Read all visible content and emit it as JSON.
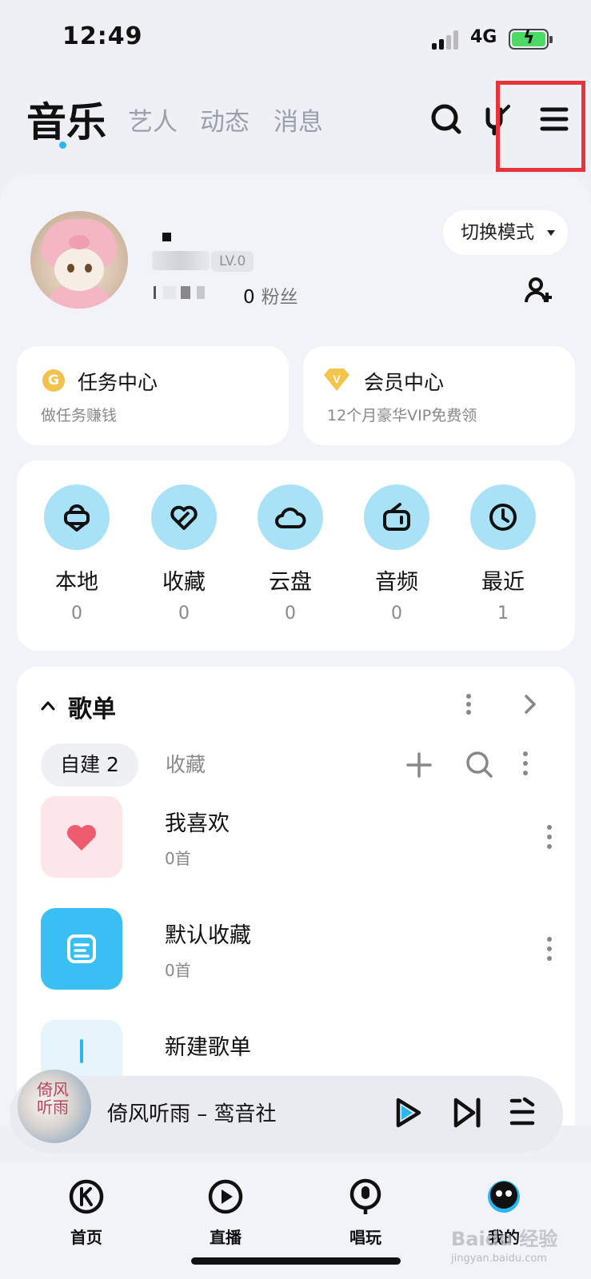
{
  "status": {
    "time": "12:49",
    "network": "4G"
  },
  "top_nav": {
    "tabs": [
      {
        "label": "音乐",
        "active": true
      },
      {
        "label": "艺人",
        "active": false
      },
      {
        "label": "动态",
        "active": false
      },
      {
        "label": "消息",
        "active": false
      }
    ]
  },
  "profile": {
    "level": "LV.0",
    "fans_count": "0",
    "fans_label": "粉丝",
    "mode_button": "切换模式"
  },
  "cards": {
    "task": {
      "icon_letter": "G",
      "title": "任务中心",
      "subtitle": "做任务赚钱"
    },
    "vip": {
      "icon_letter": "V",
      "title": "会员中心",
      "subtitle": "12个月豪华VIP免费领"
    }
  },
  "quick": [
    {
      "label": "本地",
      "count": "0",
      "icon": "local-icon"
    },
    {
      "label": "收藏",
      "count": "0",
      "icon": "favorite-icon"
    },
    {
      "label": "云盘",
      "count": "0",
      "icon": "cloud-icon"
    },
    {
      "label": "音频",
      "count": "0",
      "icon": "audio-icon"
    },
    {
      "label": "最近",
      "count": "1",
      "icon": "recent-icon"
    }
  ],
  "playlist": {
    "title": "歌单",
    "segment_active": "自建 2",
    "segment_other": "收藏",
    "items": [
      {
        "name": "我喜欢",
        "count": "0首"
      },
      {
        "name": "默认收藏",
        "count": "0首"
      },
      {
        "name": "新建歌单"
      }
    ]
  },
  "player": {
    "title": "倚风听雨 – 鸾音社",
    "cover_text": "倚风听雨"
  },
  "tabbar": [
    {
      "label": "首页",
      "icon": "home-k-icon"
    },
    {
      "label": "直播",
      "icon": "live-icon"
    },
    {
      "label": "唱玩",
      "icon": "mic-icon"
    },
    {
      "label": "我的",
      "icon": "me-icon"
    }
  ],
  "watermark": {
    "line1": "Baidu 经验",
    "line2": "jingyan.baidu.com"
  },
  "colors": {
    "accent": "#2ab6f0",
    "quick_bg": "#a9e2f7",
    "highlight": "#e8333b",
    "coin": "#f2c14e",
    "vip": "#f5c44a"
  }
}
